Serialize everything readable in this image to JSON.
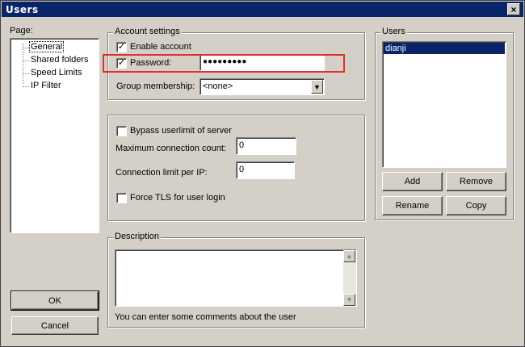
{
  "window": {
    "title": "Users",
    "close_glyph": "×"
  },
  "page_panel": {
    "label": "Page:",
    "items": [
      {
        "label": "General",
        "selected": true
      },
      {
        "label": "Shared folders"
      },
      {
        "label": "Speed Limits"
      },
      {
        "label": "IP Filter"
      }
    ]
  },
  "account": {
    "title": "Account settings",
    "enable_label": "Enable account",
    "enable_checked": "✓",
    "password_label": "Password:",
    "password_checked": "✓",
    "password_value": "●●●●●●●●●",
    "group_label": "Group membership:",
    "group_value": "<none>"
  },
  "limits": {
    "bypass_label": "Bypass userlimit of server",
    "max_conn_label": "Maximum connection count:",
    "max_conn_value": "0",
    "per_ip_label": "Connection limit per IP:",
    "per_ip_value": "0",
    "tls_label": "Force TLS for user login"
  },
  "description": {
    "title": "Description",
    "hint": "You can enter some comments about the user"
  },
  "users": {
    "title": "Users",
    "list": [
      "dianji"
    ],
    "add": "Add",
    "remove": "Remove",
    "rename": "Rename",
    "copy": "Copy"
  },
  "buttons": {
    "ok": "OK",
    "cancel": "Cancel"
  },
  "colors": {
    "selection": "#0a246a",
    "highlight": "#e03030",
    "face": "#d4d0c8"
  }
}
